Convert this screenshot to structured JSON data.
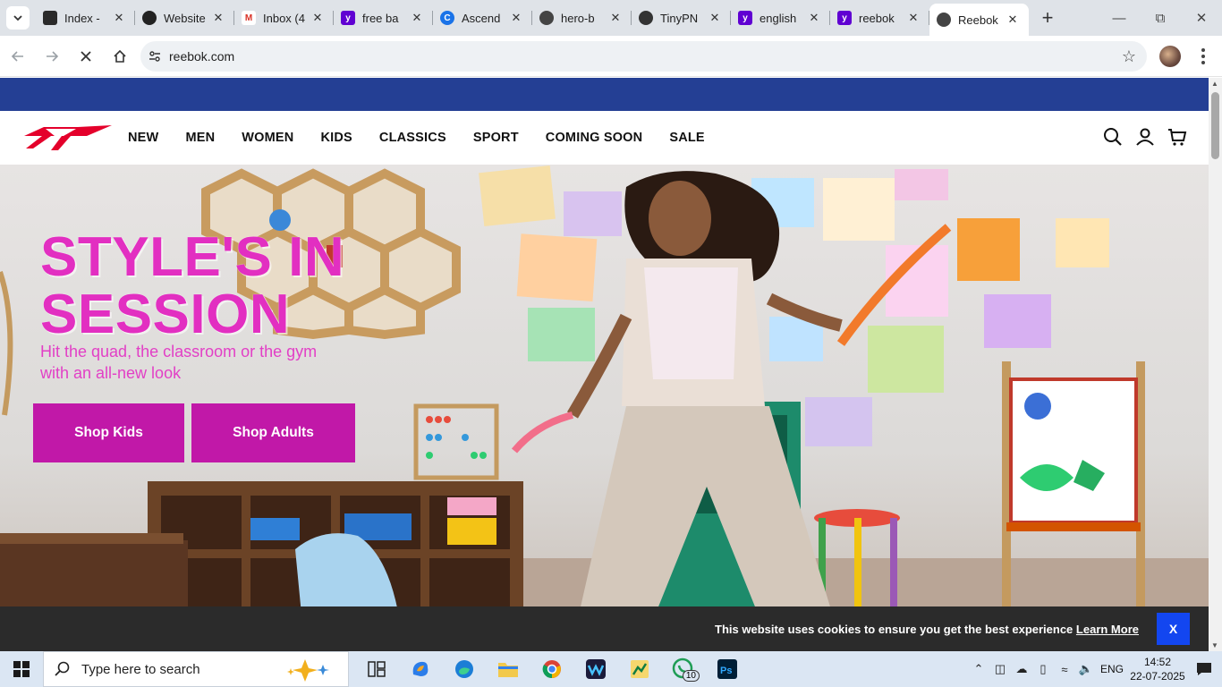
{
  "browser": {
    "tabs": [
      {
        "title": "Index -",
        "favicon": "dark-square",
        "color": "#2a2a2a"
      },
      {
        "title": "Website",
        "favicon": "openai",
        "color": "#222222"
      },
      {
        "title": "Inbox (4",
        "favicon": "gmail",
        "color": "#d93025"
      },
      {
        "title": "free ba",
        "favicon": "yahoo",
        "color": "#6001d2"
      },
      {
        "title": "Ascend",
        "favicon": "ascend",
        "color": "#1a73e8"
      },
      {
        "title": "hero-b",
        "favicon": "globe",
        "color": "#444444"
      },
      {
        "title": "TinyPN",
        "favicon": "panda",
        "color": "#333333"
      },
      {
        "title": "english",
        "favicon": "yahoo",
        "color": "#6001d2"
      },
      {
        "title": "reebok",
        "favicon": "yahoo",
        "color": "#6001d2"
      },
      {
        "title": "Reebok",
        "favicon": "loading",
        "color": "#444444",
        "active": true
      }
    ],
    "url": "reebok.com"
  },
  "site": {
    "nav": [
      "NEW",
      "MEN",
      "WOMEN",
      "KIDS",
      "CLASSICS",
      "SPORT",
      "COMING SOON",
      "SALE"
    ],
    "hero": {
      "title_line1": "STYLE'S IN",
      "title_line2": "SESSION",
      "subtitle": "Hit the quad, the classroom or the gym with an all-new look",
      "btn_kids": "Shop Kids",
      "btn_adults": "Shop Adults"
    },
    "cookie": {
      "text": "This website uses cookies to ensure you get the best experience",
      "link": "Learn More",
      "close": "X"
    }
  },
  "taskbar": {
    "search_placeholder": "Type here to search",
    "whatsapp_badge": "10",
    "language": "ENG",
    "time": "14:52",
    "date": "22-07-2025"
  },
  "colors": {
    "promo_bar": "#243f94",
    "hero_pink": "#e22fc1",
    "button_magenta": "#c118a8",
    "cookie_close": "#1346f0"
  }
}
